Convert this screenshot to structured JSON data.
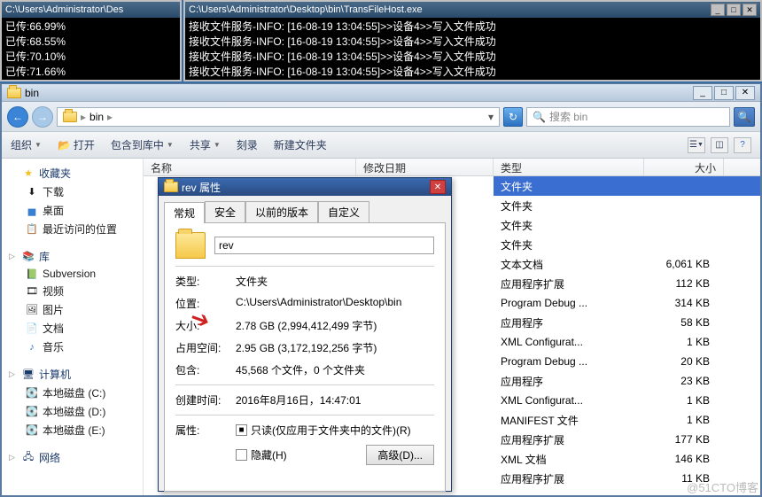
{
  "cmd1": {
    "title": "C:\\Users\\Administrator\\Des",
    "lines": [
      "已传:66.99%",
      "已传:68.55%",
      "已传:70.10%",
      "已传:71.66%"
    ]
  },
  "cmd2": {
    "title": "C:\\Users\\Administrator\\Desktop\\bin\\TransFileHost.exe",
    "lines": [
      "接收文件服务-INFO: [16-08-19 13:04:55]>>设备4>>写入文件成功",
      "接收文件服务-INFO: [16-08-19 13:04:55]>>设备4>>写入文件成功",
      "接收文件服务-INFO: [16-08-19 13:04:55]>>设备4>>写入文件成功",
      "接收文件服务-INFO: [16-08-19 13:04:55]>>设备4>>写入文件成功"
    ]
  },
  "explorer": {
    "title": "bin",
    "breadcrumb": {
      "root": "",
      "folder": "bin"
    },
    "search_placeholder": "搜索 bin",
    "commands": {
      "organize": "组织",
      "open": "打开",
      "include": "包含到库中",
      "share": "共享",
      "burn": "刻录",
      "newfolder": "新建文件夹"
    },
    "columns": {
      "name": "名称",
      "date": "修改日期",
      "type": "类型",
      "size": "大小"
    },
    "nav": {
      "favorites": "收藏夹",
      "downloads": "下载",
      "desktop": "桌面",
      "recent": "最近访问的位置",
      "libraries": "库",
      "subversion": "Subversion",
      "videos": "视频",
      "pictures": "图片",
      "documents": "文档",
      "music": "音乐",
      "computer": "计算机",
      "driveC": "本地磁盘 (C:)",
      "driveD": "本地磁盘 (D:)",
      "driveE": "本地磁盘 (E:)",
      "network": "网络"
    },
    "files": [
      {
        "type": "文件夹",
        "size": "",
        "selected": true
      },
      {
        "type": "文件夹",
        "size": ""
      },
      {
        "type": "文件夹",
        "size": ""
      },
      {
        "type": "文件夹",
        "size": ""
      },
      {
        "type": "文本文档",
        "size": "6,061 KB"
      },
      {
        "type": "应用程序扩展",
        "size": "112 KB"
      },
      {
        "type": "Program Debug ...",
        "size": "314 KB"
      },
      {
        "type": "应用程序",
        "size": "58 KB"
      },
      {
        "type": "XML Configurat...",
        "size": "1 KB"
      },
      {
        "type": "Program Debug ...",
        "size": "20 KB"
      },
      {
        "type": "应用程序",
        "size": "23 KB"
      },
      {
        "type": "XML Configurat...",
        "size": "1 KB"
      },
      {
        "type": "MANIFEST 文件",
        "size": "1 KB"
      },
      {
        "type": "应用程序扩展",
        "size": "177 KB"
      },
      {
        "type": "XML 文档",
        "size": "146 KB"
      },
      {
        "type": "应用程序扩展",
        "size": "11 KB"
      }
    ]
  },
  "props": {
    "title": "rev 属性",
    "tabs": {
      "general": "常规",
      "security": "安全",
      "prev": "以前的版本",
      "custom": "自定义"
    },
    "name": "rev",
    "rows": {
      "type_l": "类型:",
      "type_v": "文件夹",
      "loc_l": "位置:",
      "loc_v": "C:\\Users\\Administrator\\Desktop\\bin",
      "size_l": "大小:",
      "size_v": "2.78 GB (2,994,412,499 字节)",
      "ondisk_l": "占用空间:",
      "ondisk_v": "2.95 GB (3,172,192,256 字节)",
      "contains_l": "包含:",
      "contains_v": "45,568 个文件，0 个文件夹",
      "created_l": "创建时间:",
      "created_v": "2016年8月16日，14:47:01",
      "attr_l": "属性:",
      "readonly": "只读(仅应用于文件夹中的文件)(R)",
      "hidden": "隐藏(H)",
      "advanced": "高级(D)..."
    }
  },
  "watermark": "@51CTO博客"
}
